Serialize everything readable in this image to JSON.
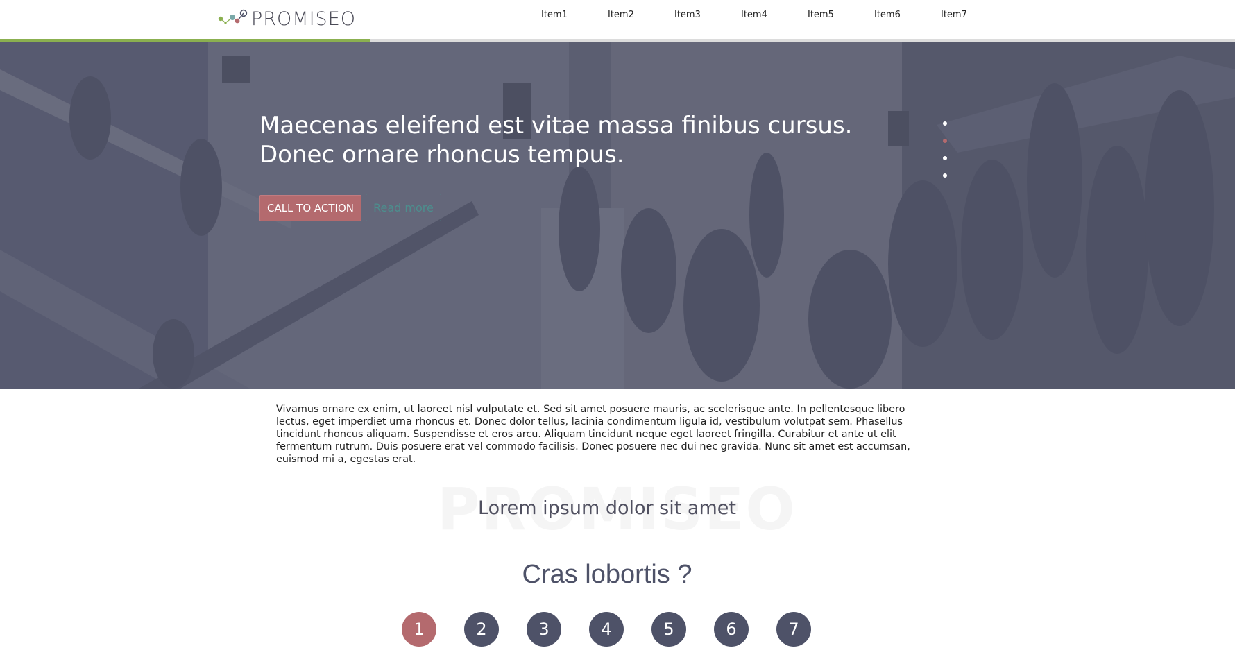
{
  "brand": {
    "logo_text": "PROMISEO",
    "progress_percent": 30,
    "colors": {
      "accent_green": "#8bb050",
      "accent_rose": "#b46a6e",
      "accent_teal": "#4c8f8e",
      "slate": "#4e5268"
    }
  },
  "nav": {
    "items": [
      {
        "label": "Item1"
      },
      {
        "label": "Item2"
      },
      {
        "label": "Item3"
      },
      {
        "label": "Item4"
      },
      {
        "label": "Item5"
      },
      {
        "label": "Item6"
      },
      {
        "label": "Item7"
      }
    ]
  },
  "hero": {
    "title_line1": "Maecenas eleifend est vitae massa finibus cursus.",
    "title_line2": "Donec ornare rhoncus tempus.",
    "cta_label": "CALL TO ACTION",
    "read_more_label": "Read more",
    "slides": 4,
    "active_slide": 2
  },
  "intro": {
    "text": "Vivamus ornare ex enim, ut laoreet nisl vulputate et. Sed sit amet posuere mauris, ac scelerisque ante. In pellentesque libero lectus, eget imperdiet urna rhoncus et. Donec dolor tellus, lacinia condimentum ligula id, vestibulum volutpat sem. Phasellus tincidunt rhoncus aliquam. Suspendisse et eros arcu. Aliquam tincidunt neque eget laoreet fringilla. Curabitur et ante ut elit fermentum rutrum. Duis posuere erat vel commodo facilisis. Donec posuere nec dui nec gravida. Nunc sit amet est accumsan, euismod mi a, egestas erat."
  },
  "section": {
    "watermark": "PROMISEO",
    "title": "Lorem ipsum dolor sit amet"
  },
  "quiz": {
    "question": "Cras lobortis ?",
    "steps": [
      "1",
      "2",
      "3",
      "4",
      "5",
      "6",
      "7"
    ],
    "active_step": 1
  }
}
